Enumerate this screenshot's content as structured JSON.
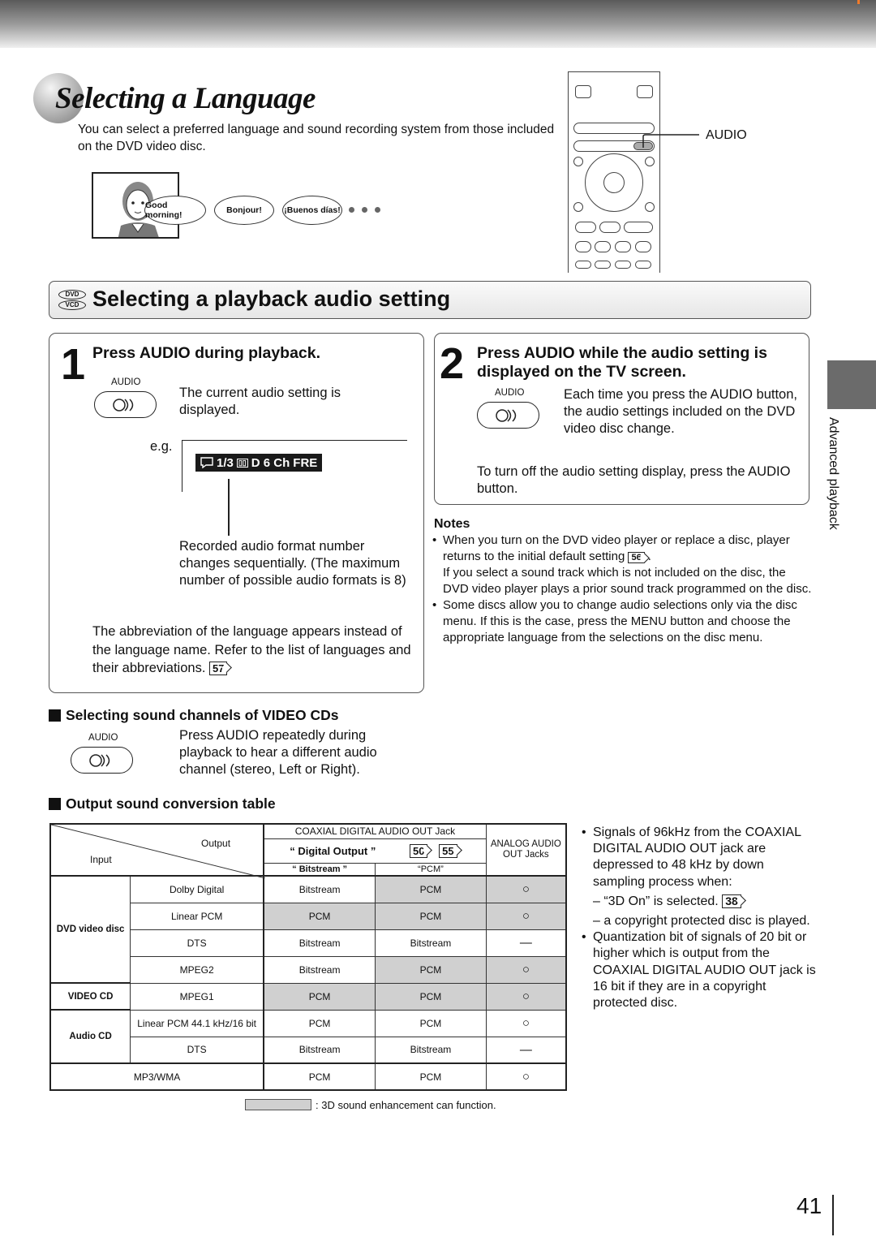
{
  "page": {
    "title": "Selecting a Language",
    "intro": "You can select a preferred language and sound recording system from those included on the DVD video disc.",
    "page_number": "41",
    "side_tab_label": "Advanced playback"
  },
  "illustration": {
    "bubbles": [
      "Good morning!",
      "Bonjour!",
      "¡Buenos días!"
    ],
    "remote_callout": "AUDIO"
  },
  "section": {
    "disc_icons": [
      "DVD",
      "VCD"
    ],
    "title": "Selecting a playback audio setting"
  },
  "step1": {
    "number": "1",
    "heading": "Press AUDIO during playback.",
    "button_label": "AUDIO",
    "text": "The current audio setting is displayed.",
    "eg_label": "e.g.",
    "osd": {
      "count": "1/3",
      "format": "D 6 Ch",
      "language": "FRE"
    },
    "callout": "Recorded audio format number changes sequentially. (The maximum number of possible audio formats is 8)",
    "abbr_text": "The abbreviation of the language appears instead of the language name. Refer to the list of languages and their abbreviations.",
    "abbr_ref": "57"
  },
  "step2": {
    "number": "2",
    "heading": "Press AUDIO while the audio setting is displayed on the TV screen.",
    "button_label": "AUDIO",
    "text": "Each time you press the AUDIO button, the audio settings included on the DVD video disc change.",
    "off_text": "To turn off the audio setting display, press the AUDIO button."
  },
  "notes": {
    "heading": "Notes",
    "items": [
      {
        "text1": "When you turn on the DVD video player or replace a disc, player returns to the initial default setting",
        "ref": "56",
        "text2": "If you select a sound track which is not included on the disc, the DVD video player plays a prior sound track programmed on the disc."
      },
      {
        "text1": "Some discs allow you to change audio selections only via the disc menu.  If this is the case, press the MENU button and choose the appropriate language from the selections on the disc menu."
      }
    ]
  },
  "vcd": {
    "heading": "Selecting sound channels of VIDEO CDs",
    "button_label": "AUDIO",
    "text": "Press AUDIO repeatedly during playback to hear a different audio channel (stereo, Left or Right)."
  },
  "table": {
    "heading": "Output sound conversion table",
    "header": {
      "output": "Output",
      "input": "Input",
      "coaxial": "COAXIAL DIGITAL AUDIO OUT Jack",
      "digital_output": "“ Digital Output  ”",
      "refs": [
        "50",
        "55"
      ],
      "bitstream": "“ Bitstream ”",
      "pcm": "“PCM”",
      "analog": "ANALOG AUDIO OUT Jacks"
    },
    "groups": [
      "DVD video disc",
      "VIDEO CD",
      "Audio CD"
    ],
    "rows": [
      {
        "format": "Dolby Digital",
        "bitstream": "Bitstream",
        "pcm": "PCM",
        "analog": "○",
        "shade": [
          false,
          true,
          true
        ]
      },
      {
        "format": "Linear PCM",
        "bitstream": "PCM",
        "pcm": "PCM",
        "analog": "○",
        "shade": [
          true,
          true,
          true
        ]
      },
      {
        "format": "DTS",
        "bitstream": "Bitstream",
        "pcm": "Bitstream",
        "analog": "—",
        "shade": [
          false,
          false,
          false
        ]
      },
      {
        "format": "MPEG2",
        "bitstream": "Bitstream",
        "pcm": "PCM",
        "analog": "○",
        "shade": [
          false,
          true,
          true
        ]
      },
      {
        "format": "MPEG1",
        "bitstream": "PCM",
        "pcm": "PCM",
        "analog": "○",
        "shade": [
          true,
          true,
          true
        ]
      },
      {
        "format": "Linear PCM 44.1 kHz/16 bit",
        "bitstream": "PCM",
        "pcm": "PCM",
        "analog": "○",
        "shade": [
          false,
          false,
          false
        ]
      },
      {
        "format": "DTS",
        "bitstream": "Bitstream",
        "pcm": "Bitstream",
        "analog": "—",
        "shade": [
          false,
          false,
          false
        ]
      },
      {
        "format": "MP3/WMA",
        "bitstream": "PCM",
        "pcm": "PCM",
        "analog": "○",
        "shade": [
          false,
          false,
          false
        ]
      }
    ],
    "legend": ": 3D sound enhancement can function.",
    "shade_color": "#d0d0d0"
  },
  "right_notes": {
    "item1": "Signals of 96kHz from the COAXIAL DIGITAL AUDIO OUT jack are depressed to 48 kHz by down sampling process when:",
    "sub1": "– “3D On” is selected.",
    "sub1_ref": "38",
    "sub2": "– a copyright protected disc is played.",
    "item2": "Quantization bit of signals of 20 bit or higher which is output from the COAXIAL DIGITAL AUDIO OUT jack is 16 bit if they are in a copyright protected disc."
  }
}
